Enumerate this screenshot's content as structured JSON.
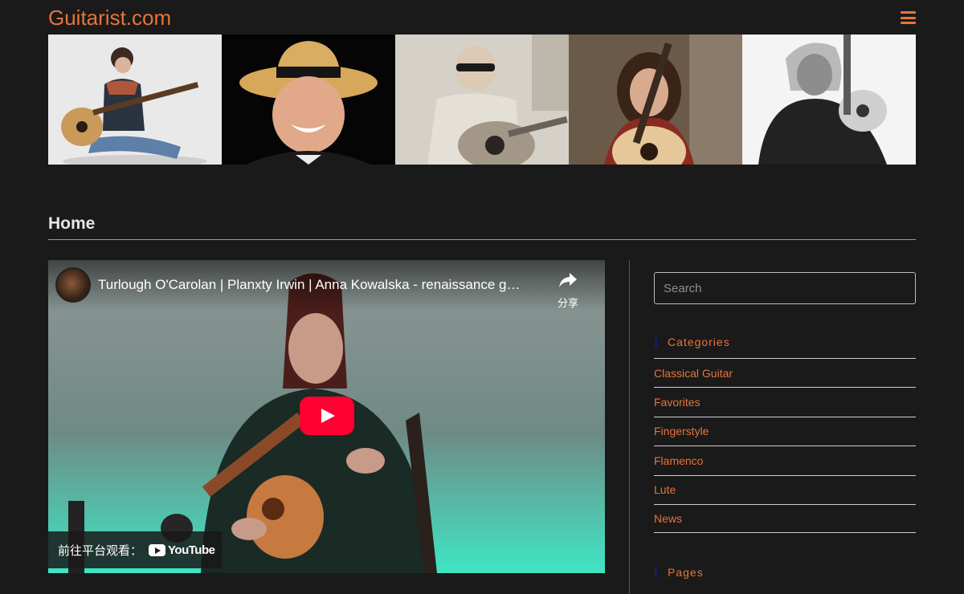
{
  "site": {
    "title": "Guitarist.com"
  },
  "header_images": [
    {
      "icon": "guitarist-photo-icon"
    },
    {
      "icon": "guitarist-photo-icon"
    },
    {
      "icon": "guitarist-photo-icon"
    },
    {
      "icon": "guitarist-photo-icon"
    },
    {
      "icon": "guitarist-photo-icon"
    }
  ],
  "page": {
    "heading": "Home"
  },
  "video": {
    "title": "Turlough O'Carolan | Planxty Irwin | Anna Kowalska - renaissance g…",
    "share_label": "分享",
    "watch_on_label": "前往平台观看：",
    "platform_label": "YouTube",
    "play_color": "#ff0033"
  },
  "sidebar": {
    "search_placeholder": "Search",
    "categories_title": "Categories",
    "categories": [
      "Classical Guitar",
      "Favorites",
      "Fingerstyle",
      "Flamenco",
      "Lute",
      "News"
    ],
    "pages_title": "Pages"
  },
  "colors": {
    "accent": "#e8733a",
    "background": "#1a1a1a",
    "widget_marker": "#1b1a6e"
  }
}
